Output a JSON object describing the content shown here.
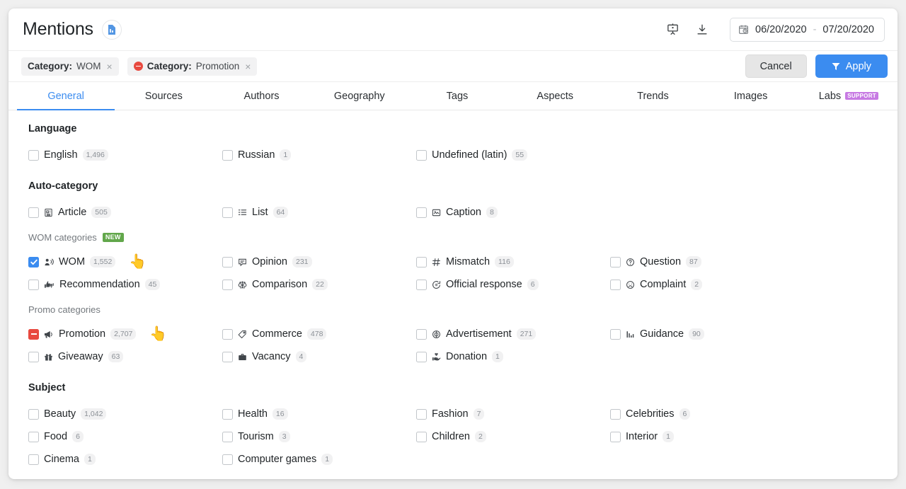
{
  "header": {
    "title": "Mentions",
    "doc_icon": "document-icon",
    "presentation_icon": "presentation-icon",
    "download_icon": "download-icon",
    "calendar_icon": "calendar-icon",
    "date_from": "06/20/2020",
    "date_separator": "-",
    "date_to": "07/20/2020"
  },
  "filterbar": {
    "chips": [
      {
        "prefix": "Category:",
        "value": "WOM",
        "excluded": false,
        "close": "×"
      },
      {
        "prefix": "Category:",
        "value": "Promotion",
        "excluded": true,
        "close": "×"
      }
    ],
    "cancel_label": "Cancel",
    "apply_label": "Apply",
    "apply_icon": "filter-funnel-icon"
  },
  "tabs": [
    {
      "label": "General",
      "active": true
    },
    {
      "label": "Sources",
      "active": false
    },
    {
      "label": "Authors",
      "active": false
    },
    {
      "label": "Geography",
      "active": false
    },
    {
      "label": "Tags",
      "active": false
    },
    {
      "label": "Aspects",
      "active": false
    },
    {
      "label": "Trends",
      "active": false
    },
    {
      "label": "Images",
      "active": false
    },
    {
      "label": "Labs",
      "active": false,
      "badge": "SUPPORT"
    }
  ],
  "sections": {
    "language": {
      "title": "Language",
      "items": [
        {
          "label": "English",
          "count": "1,496",
          "state": "unchecked"
        },
        {
          "label": "Russian",
          "count": "1",
          "state": "unchecked"
        },
        {
          "label": "Undefined (latin)",
          "count": "55",
          "state": "unchecked"
        }
      ]
    },
    "auto_category": {
      "title": "Auto-category",
      "items": [
        {
          "label": "Article",
          "count": "505",
          "state": "unchecked",
          "icon": "article-icon"
        },
        {
          "label": "List",
          "count": "64",
          "state": "unchecked",
          "icon": "list-icon"
        },
        {
          "label": "Caption",
          "count": "8",
          "state": "unchecked",
          "icon": "caption-icon"
        }
      ]
    },
    "wom_categories": {
      "title": "WOM categories",
      "badge": "NEW",
      "items": [
        {
          "label": "WOM",
          "count": "1,552",
          "state": "checked",
          "icon": "speaking-person-icon",
          "pointer": true
        },
        {
          "label": "Opinion",
          "count": "231",
          "state": "unchecked",
          "icon": "speech-bubble-icon"
        },
        {
          "label": "Mismatch",
          "count": "116",
          "state": "unchecked",
          "icon": "hash-icon"
        },
        {
          "label": "Question",
          "count": "87",
          "state": "unchecked",
          "icon": "question-circle-icon"
        },
        {
          "label": "Recommendation",
          "count": "45",
          "state": "unchecked",
          "icon": "thumbs-icon"
        },
        {
          "label": "Comparison",
          "count": "22",
          "state": "unchecked",
          "icon": "scales-icon"
        },
        {
          "label": "Official response",
          "count": "6",
          "state": "unchecked",
          "icon": "official-response-icon"
        },
        {
          "label": "Complaint",
          "count": "2",
          "state": "unchecked",
          "icon": "sad-face-icon"
        }
      ]
    },
    "promo_categories": {
      "title": "Promo categories",
      "items": [
        {
          "label": "Promotion",
          "count": "2,707",
          "state": "excluded",
          "icon": "megaphone-icon",
          "pointer": true
        },
        {
          "label": "Commerce",
          "count": "478",
          "state": "unchecked",
          "icon": "tag-icon"
        },
        {
          "label": "Advertisement",
          "count": "271",
          "state": "unchecked",
          "icon": "target-icon"
        },
        {
          "label": "Guidance",
          "count": "90",
          "state": "unchecked",
          "icon": "bar-chart-icon"
        },
        {
          "label": "Giveaway",
          "count": "63",
          "state": "unchecked",
          "icon": "gift-icon"
        },
        {
          "label": "Vacancy",
          "count": "4",
          "state": "unchecked",
          "icon": "briefcase-icon"
        },
        {
          "label": "Donation",
          "count": "1",
          "state": "unchecked",
          "icon": "donation-hand-icon"
        }
      ]
    },
    "subject": {
      "title": "Subject",
      "items": [
        {
          "label": "Beauty",
          "count": "1,042",
          "state": "unchecked"
        },
        {
          "label": "Health",
          "count": "16",
          "state": "unchecked"
        },
        {
          "label": "Fashion",
          "count": "7",
          "state": "unchecked"
        },
        {
          "label": "Celebrities",
          "count": "6",
          "state": "unchecked"
        },
        {
          "label": "Food",
          "count": "6",
          "state": "unchecked"
        },
        {
          "label": "Tourism",
          "count": "3",
          "state": "unchecked"
        },
        {
          "label": "Children",
          "count": "2",
          "state": "unchecked"
        },
        {
          "label": "Interior",
          "count": "1",
          "state": "unchecked"
        },
        {
          "label": "Cinema",
          "count": "1",
          "state": "unchecked"
        },
        {
          "label": "Computer games",
          "count": "1",
          "state": "unchecked"
        }
      ]
    }
  },
  "colors": {
    "accent": "#3b8cf0",
    "exclude": "#e8493f",
    "new_badge": "#62a74b",
    "support_badge": "#c77ae3"
  }
}
